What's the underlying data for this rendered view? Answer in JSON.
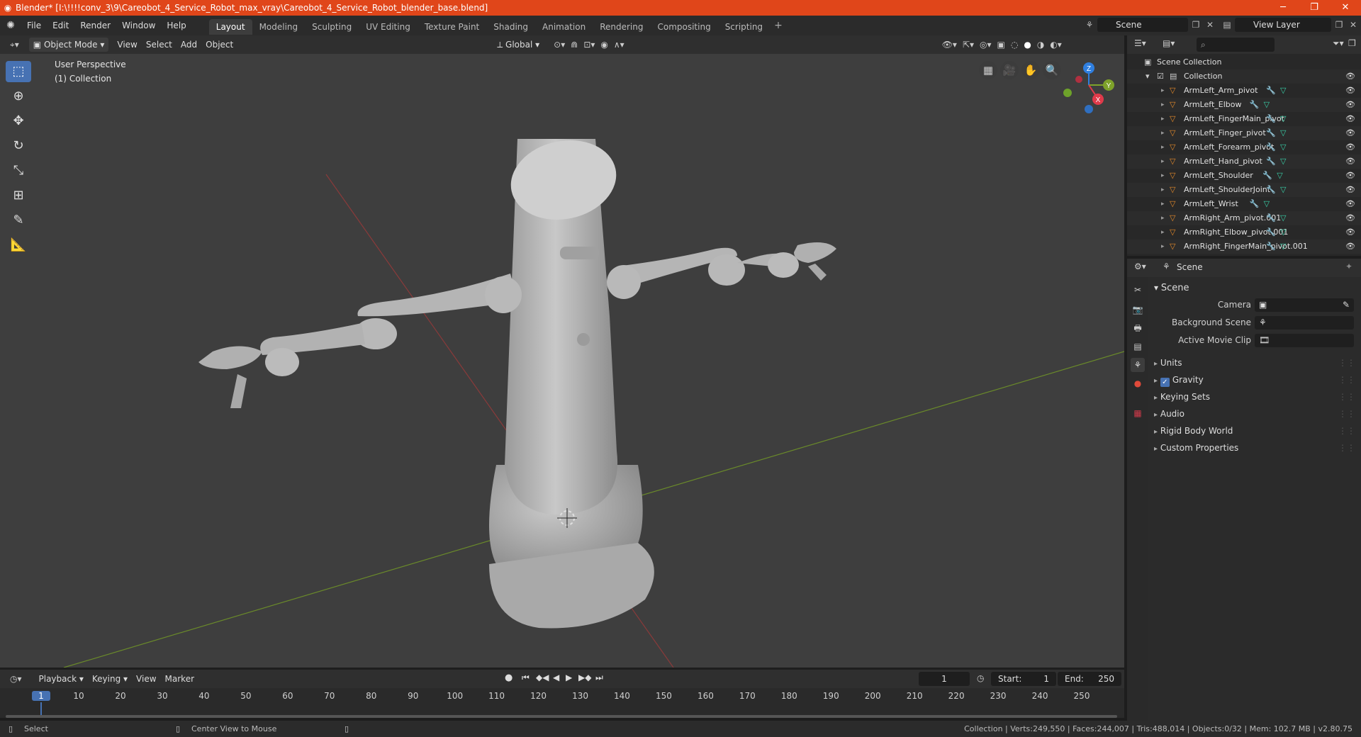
{
  "window": {
    "title": "Blender* [I:\\!!!!conv_3\\9\\Careobot_4_Service_Robot_max_vray\\Careobot_4_Service_Robot_blender_base.blend]",
    "minimize": "─",
    "maximize": "❐",
    "close": "✕"
  },
  "menu": [
    "File",
    "Edit",
    "Render",
    "Window",
    "Help"
  ],
  "workspaces": [
    {
      "label": "Layout",
      "active": true
    },
    {
      "label": "Modeling"
    },
    {
      "label": "Sculpting"
    },
    {
      "label": "UV Editing"
    },
    {
      "label": "Texture Paint"
    },
    {
      "label": "Shading"
    },
    {
      "label": "Animation"
    },
    {
      "label": "Rendering"
    },
    {
      "label": "Compositing"
    },
    {
      "label": "Scripting"
    }
  ],
  "scene_name": "Scene",
  "view_layer": "View Layer",
  "viewport_header": {
    "mode": "Object Mode",
    "menus": [
      "View",
      "Select",
      "Add",
      "Object"
    ],
    "transform": "Global"
  },
  "viewport": {
    "view_name": "User Perspective",
    "collection": "(1) Collection",
    "gizmo": {
      "z": "Z",
      "y": "Y",
      "x": "X"
    }
  },
  "outliner": {
    "root": "Scene Collection",
    "collection": "Collection",
    "objects": [
      "ArmLeft_Arm_pivot",
      "ArmLeft_Elbow",
      "ArmLeft_FingerMain_pivot",
      "ArmLeft_Finger_pivot",
      "ArmLeft_Forearm_pivot",
      "ArmLeft_Hand_pivot",
      "ArmLeft_Shoulder",
      "ArmLeft_ShoulderJoint",
      "ArmLeft_Wrist",
      "ArmRight_Arm_pivot.001",
      "ArmRight_Elbow_pivot.001",
      "ArmRight_FingerMain_pivot.001"
    ]
  },
  "properties": {
    "context": "Scene",
    "panel": "Scene",
    "fields": [
      {
        "label": "Camera"
      },
      {
        "label": "Background Scene"
      },
      {
        "label": "Active Movie Clip"
      }
    ],
    "sections": [
      "Units",
      "Gravity",
      "Keying Sets",
      "Audio",
      "Rigid Body World",
      "Custom Properties"
    ],
    "gravity_enabled": true
  },
  "timeline": {
    "menus": [
      "Playback",
      "Keying",
      "View",
      "Marker"
    ],
    "current_frame": "1",
    "start_label": "Start:",
    "start": "1",
    "end_label": "End:",
    "end": "250",
    "ticks": [
      "1",
      "10",
      "20",
      "30",
      "40",
      "50",
      "60",
      "70",
      "80",
      "90",
      "100",
      "110",
      "120",
      "130",
      "140",
      "150",
      "160",
      "170",
      "180",
      "190",
      "200",
      "210",
      "220",
      "230",
      "240",
      "250"
    ]
  },
  "statusbar": {
    "select": "Select",
    "center_view": "Center View to Mouse",
    "stats": "Collection | Verts:249,550 | Faces:244,007 | Tris:488,014 | Objects:0/32 | Mem: 102.7 MB | v2.80.75"
  },
  "colors": {
    "titlebar": "#e0461a",
    "accent": "#4772b3",
    "object_icon": "#e58a2a",
    "modifier_icon": "#6fa8ff",
    "mesh_icon": "#39d1a8"
  }
}
